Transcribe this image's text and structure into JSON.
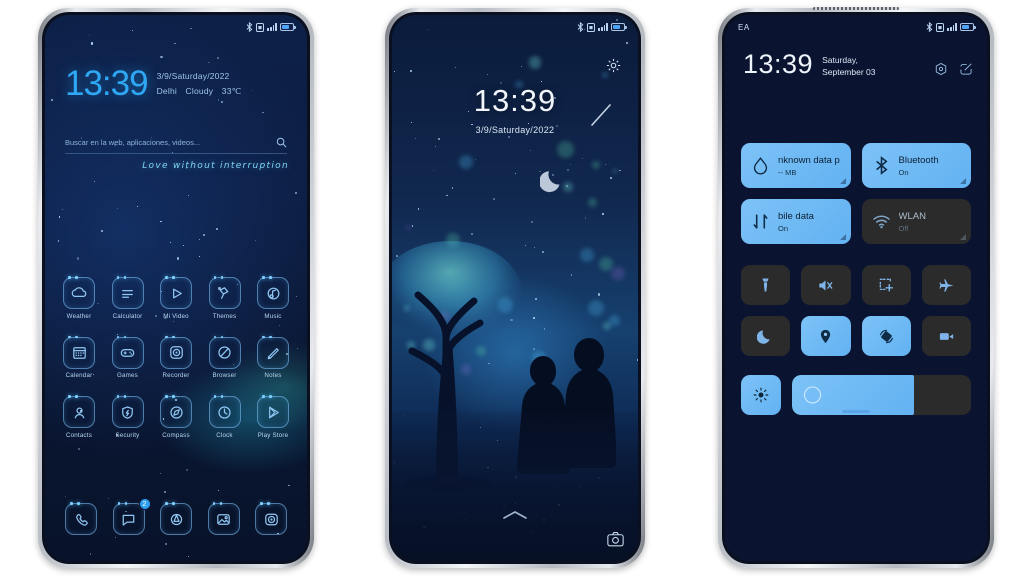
{
  "phone1": {
    "name": "home-screen",
    "statusbar": {
      "icons": [
        "bluetooth-icon",
        "sim-icon",
        "signal-icon",
        "battery-icon"
      ]
    },
    "clock": {
      "time": "13:39",
      "date": "3/9/Saturday/2022",
      "city": "Delhi",
      "condition": "Cloudy",
      "temperature": "33℃"
    },
    "search": {
      "placeholder": "Buscar en la web, aplicaciones, videos...",
      "icon": "search-icon"
    },
    "tagline": "Love without interruption",
    "apps": [
      [
        {
          "label": "Weather",
          "icon": "weather-icon"
        },
        {
          "label": "Calculator",
          "icon": "calculator-icon"
        },
        {
          "label": "Mi Video",
          "icon": "play-icon"
        },
        {
          "label": "Themes",
          "icon": "paint-roller-icon"
        },
        {
          "label": "Music",
          "icon": "music-note-icon"
        }
      ],
      [
        {
          "label": "Calendar",
          "icon": "calendar-icon"
        },
        {
          "label": "Games",
          "icon": "gamepad-icon"
        },
        {
          "label": "Recorder",
          "icon": "recorder-icon"
        },
        {
          "label": "Browser",
          "icon": "browser-icon"
        },
        {
          "label": "Notes",
          "icon": "notes-icon"
        }
      ],
      [
        {
          "label": "Contacts",
          "icon": "contacts-icon"
        },
        {
          "label": "Security",
          "icon": "shield-icon"
        },
        {
          "label": "Compass",
          "icon": "compass-icon"
        },
        {
          "label": "Clock",
          "icon": "clock-icon"
        },
        {
          "label": "Play Store",
          "icon": "play-store-icon"
        }
      ]
    ],
    "dock": [
      {
        "name": "phone-icon",
        "badge": ""
      },
      {
        "name": "messages-icon",
        "badge": "2"
      },
      {
        "name": "browser-dock-icon",
        "badge": ""
      },
      {
        "name": "gallery-icon",
        "badge": ""
      },
      {
        "name": "camera-icon",
        "badge": ""
      }
    ]
  },
  "phone2": {
    "name": "lock-screen",
    "time": "13:39",
    "date": "3/9/Saturday/2022",
    "gear_icon": "gear-icon",
    "unlock_hint_icon": "chevron-up-icon",
    "camera_icon": "camera-icon",
    "scene": [
      "crescent-moon",
      "shooting-star",
      "tree",
      "couple-silhouette"
    ]
  },
  "phone3": {
    "name": "quick-settings",
    "carrier": "EA",
    "time": "13:39",
    "date": "Saturday, September 03",
    "actions": [
      {
        "name": "settings-icon"
      },
      {
        "name": "edit-icon"
      }
    ],
    "big_tiles": [
      {
        "title": "nknown data p",
        "subtitle": "-- MB",
        "state": "on",
        "icon": "data-usage-icon"
      },
      {
        "title": "Bluetooth",
        "subtitle": "On",
        "state": "on",
        "icon": "bluetooth-icon"
      },
      {
        "title": "bile data",
        "subtitle": "On",
        "state": "on",
        "icon": "mobile-data-icon"
      },
      {
        "title": "WLAN",
        "subtitle": "Off",
        "state": "off",
        "icon": "wifi-icon"
      }
    ],
    "small_tiles": [
      {
        "icon": "flashlight-icon",
        "state": "off"
      },
      {
        "icon": "mute-icon",
        "state": "off"
      },
      {
        "icon": "screenshot-icon",
        "state": "off"
      },
      {
        "icon": "airplane-icon",
        "state": "off"
      },
      {
        "icon": "dark-mode-icon",
        "state": "off"
      },
      {
        "icon": "location-icon",
        "state": "on"
      },
      {
        "icon": "auto-rotate-icon",
        "state": "on"
      },
      {
        "icon": "screen-record-icon",
        "state": "off"
      }
    ],
    "brightness": {
      "auto_icon": "brightness-auto-icon",
      "value": 68
    }
  },
  "colors": {
    "accent": "#2ea8f5",
    "tile_on": "#7cc2f7",
    "tile_off": "#2a2b2a",
    "screen_bg": "#0a1430",
    "page_bg": "#ffffff"
  }
}
